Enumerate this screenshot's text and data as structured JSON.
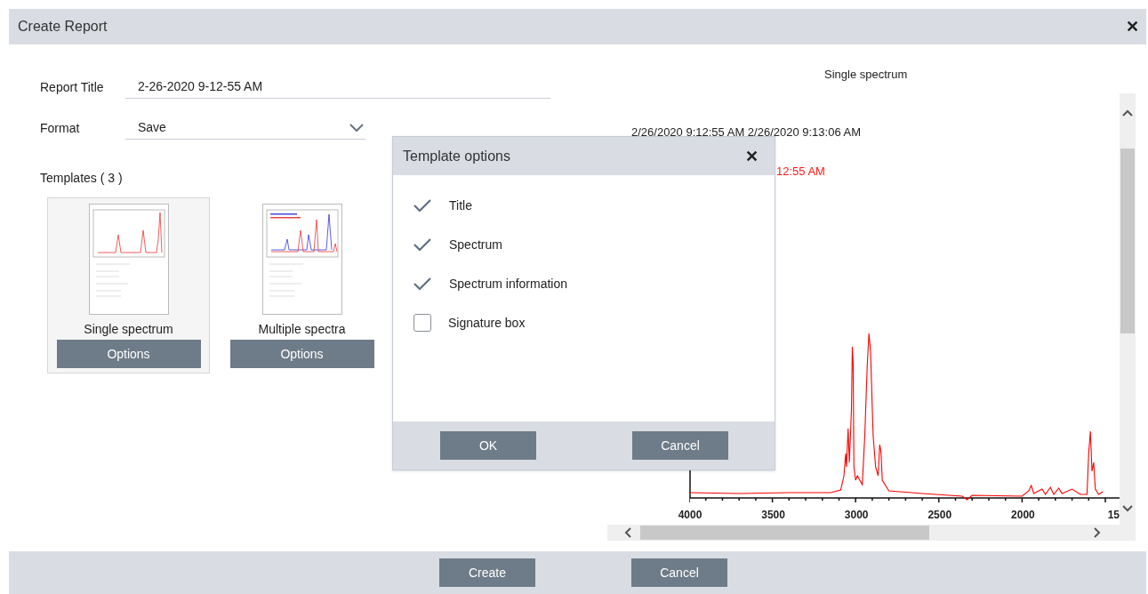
{
  "window": {
    "title": "Create Report",
    "close": "✕"
  },
  "form": {
    "report_title": {
      "label": "Report Title",
      "value": "2-26-2020 9-12-55 AM"
    },
    "format": {
      "label": "Format",
      "value": "Save"
    }
  },
  "templates": {
    "label": "Templates ( 3 )",
    "items": [
      {
        "name": "Single spectrum",
        "button": "Options",
        "selected": true,
        "kind": "single"
      },
      {
        "name": "Multiple spectra",
        "button": "Options",
        "selected": false,
        "kind": "multiple"
      }
    ]
  },
  "preview": {
    "title": "Single spectrum",
    "dates": "2/26/2020 9:12:55 AM 2/26/2020 9:13:06 AM",
    "red_text": "12:55 AM",
    "x_tick_labels": [
      "4000",
      "3500",
      "3000",
      "2500",
      "2000",
      "15"
    ]
  },
  "dialog": {
    "title": "Template options",
    "close": "✕",
    "options": [
      {
        "label": "Title",
        "checked": true
      },
      {
        "label": "Spectrum",
        "checked": true
      },
      {
        "label": "Spectrum information",
        "checked": true
      },
      {
        "label": "Signature box",
        "checked": false
      }
    ],
    "buttons": [
      "OK",
      "Cancel"
    ]
  },
  "footer": {
    "buttons": [
      "Create",
      "Cancel"
    ]
  }
}
